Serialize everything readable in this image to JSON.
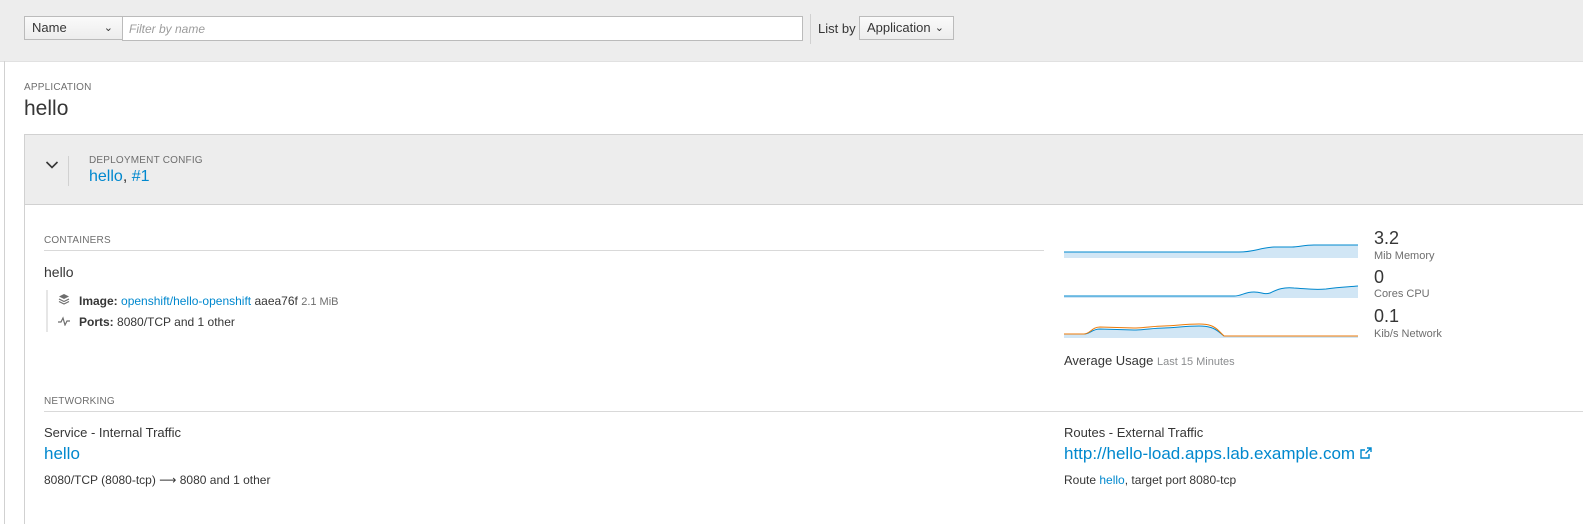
{
  "toolbar": {
    "filter_field": "Name",
    "filter_placeholder": "Filter by name",
    "filter_value": "",
    "list_by_label": "List by",
    "list_by_value": "Application"
  },
  "application": {
    "label": "APPLICATION",
    "name": "hello"
  },
  "deployment": {
    "label": "DEPLOYMENT CONFIG",
    "name": "hello",
    "separator": ", ",
    "revision": "#1"
  },
  "containers": {
    "label": "CONTAINERS",
    "name": "hello",
    "image_label": "Image:",
    "image_name": "openshift/hello-openshift",
    "image_id": "aaea76f",
    "image_size": "2.1 MiB",
    "ports_label": "Ports:",
    "ports_value": "8080/TCP and 1 other"
  },
  "metrics": {
    "memory": {
      "value": "3.2",
      "unit": "Mib Memory"
    },
    "cpu": {
      "value": "0",
      "unit": "Cores CPU"
    },
    "network": {
      "value": "0.1",
      "unit": "Kib/s Network"
    },
    "average_usage_label": "Average Usage",
    "average_usage_period": "Last 15 Minutes",
    "colors": {
      "primary": "#0088ce",
      "secondary": "#ec7a08",
      "fill": "#d1e6f5"
    }
  },
  "networking": {
    "label": "NETWORKING",
    "service_title": "Service - Internal Traffic",
    "service_name": "hello",
    "service_ports": "8080/TCP (8080-tcp)",
    "service_arrow": "⟶",
    "service_target": "8080 and 1 other",
    "routes_title": "Routes - External Traffic",
    "route_url": "http://hello-load.apps.lab.example.com",
    "route_prefix": "Route",
    "route_name": "hello",
    "route_target": ", target port 8080-tcp"
  },
  "icons": {
    "dropdown": "chevron-down-icon",
    "expand": "chevron-down-icon",
    "image": "layers-icon",
    "ports": "pulse-icon",
    "external_link": "external-link-icon"
  }
}
